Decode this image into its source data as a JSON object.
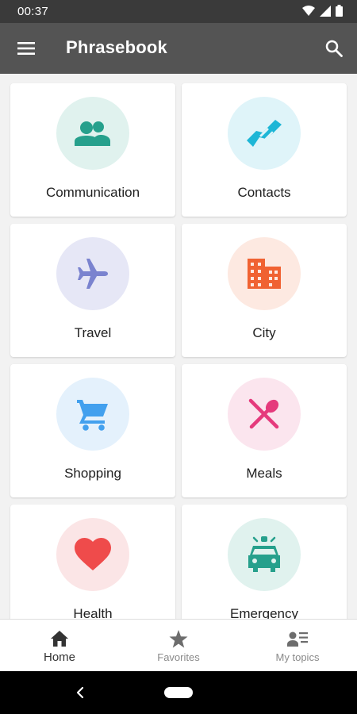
{
  "status_bar": {
    "time": "00:37",
    "icons": [
      "wifi-icon",
      "signal-icon",
      "battery-icon"
    ]
  },
  "app_bar": {
    "title": "Phrasebook",
    "menu_icon": "menu-icon",
    "search_icon": "search-icon",
    "background": "#545454"
  },
  "topics": [
    {
      "label": "Communication",
      "icon": "people-icon",
      "circle_color": "#e0f2ee",
      "icon_color": "#26a08c"
    },
    {
      "label": "Contacts",
      "icon": "handshake-icon",
      "circle_color": "#dff4f9",
      "icon_color": "#1eb6d6"
    },
    {
      "label": "Travel",
      "icon": "airplane-icon",
      "circle_color": "#e6e7f6",
      "icon_color": "#7a83cf"
    },
    {
      "label": "City",
      "icon": "building-icon",
      "circle_color": "#fde9e1",
      "icon_color": "#f06232"
    },
    {
      "label": "Shopping",
      "icon": "cart-icon",
      "circle_color": "#e4f1fc",
      "icon_color": "#42a0ee"
    },
    {
      "label": "Meals",
      "icon": "utensils-icon",
      "circle_color": "#fbe5ee",
      "icon_color": "#e53a7c"
    },
    {
      "label": "Health",
      "icon": "heart-icon",
      "circle_color": "#fbe5e6",
      "icon_color": "#ef4b4b"
    },
    {
      "label": "Emergency",
      "icon": "police-car-icon",
      "circle_color": "#e0f2ee",
      "icon_color": "#26a08c"
    }
  ],
  "bottom_nav": {
    "items": [
      {
        "label": "Home",
        "icon": "home-icon",
        "active": true
      },
      {
        "label": "Favorites",
        "icon": "star-icon",
        "active": false
      },
      {
        "label": "My topics",
        "icon": "my-topics-icon",
        "active": false
      }
    ]
  },
  "system_nav": {
    "back_icon": "back-chevron-icon",
    "home_icon": "home-pill-icon"
  }
}
